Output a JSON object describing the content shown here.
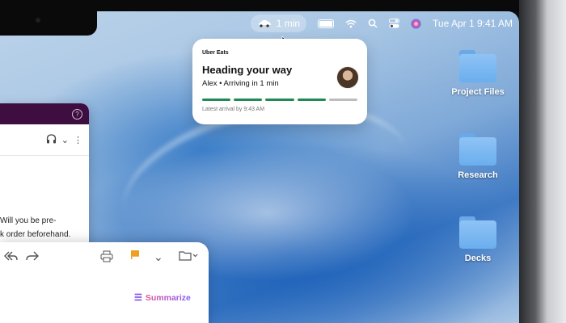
{
  "menubar": {
    "live_activity_icon": "car-icon",
    "live_activity_text": "1 min",
    "icons": [
      "battery-icon",
      "wifi-icon",
      "search-icon",
      "control-center-icon",
      "siri-icon"
    ],
    "datetime": "Tue Apr 1  9:41 AM"
  },
  "notification": {
    "brand": "Uber Eats",
    "title": "Heading your way",
    "subtitle": "Alex • Arriving in 1 min",
    "progress": {
      "segments": 5,
      "completed": 4
    },
    "footer": "Latest arrival by 9:43 AM",
    "colors": {
      "progress_done": "#1f8a55",
      "progress_todo": "#bdbdbd"
    }
  },
  "desktop": {
    "folders": [
      {
        "label": "Project Files"
      },
      {
        "label": "Research"
      },
      {
        "label": "Decks"
      }
    ]
  },
  "back_window": {
    "header_color": "#3f0e40",
    "help_icon": "help-icon",
    "text_line_1": "Will you be pre-",
    "text_line_2": "k order beforehand."
  },
  "mail_window": {
    "summarize_label": "Summarize",
    "summarize_gradient": [
      "#ff4f7b",
      "#7a5cff"
    ]
  }
}
